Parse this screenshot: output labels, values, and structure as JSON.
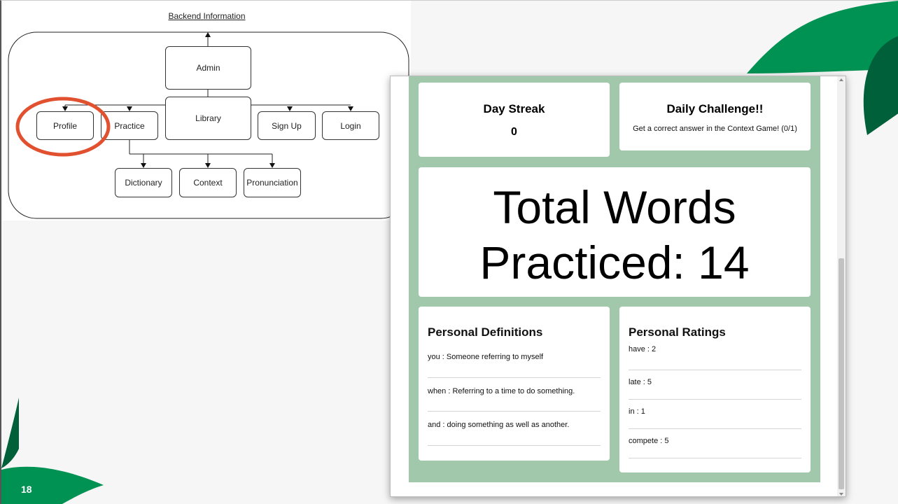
{
  "slide": {
    "number": "18",
    "colors": {
      "green": "#009253",
      "dark_green": "#00603a"
    }
  },
  "diagram": {
    "title": "Backend Information",
    "nodes": {
      "admin": "Admin",
      "library": "Library",
      "profile": "Profile",
      "practice": "Practice",
      "signup": "Sign Up",
      "login": "Login",
      "dictionary": "Dictionary",
      "context": "Context",
      "pronunciation": "Pronunciation"
    },
    "highlight_color": "#e2512f"
  },
  "app": {
    "background": "#a1c8aa",
    "streak": {
      "title": "Day Streak",
      "value": "0"
    },
    "challenge": {
      "title": "Daily Challenge!!",
      "text": "Get a correct answer in the Context Game! (0/1)"
    },
    "total": {
      "line1": "Total Words",
      "line2": "Practiced: 14"
    },
    "definitions": {
      "title": "Personal Definitions",
      "items": [
        "you : Someone referring to myself",
        "when : Referring to a time to do something.",
        "and : doing something as well as another."
      ]
    },
    "ratings": {
      "title": "Personal Ratings",
      "items": [
        "have : 2",
        "late : 5",
        "in : 1",
        "compete : 5"
      ]
    }
  }
}
